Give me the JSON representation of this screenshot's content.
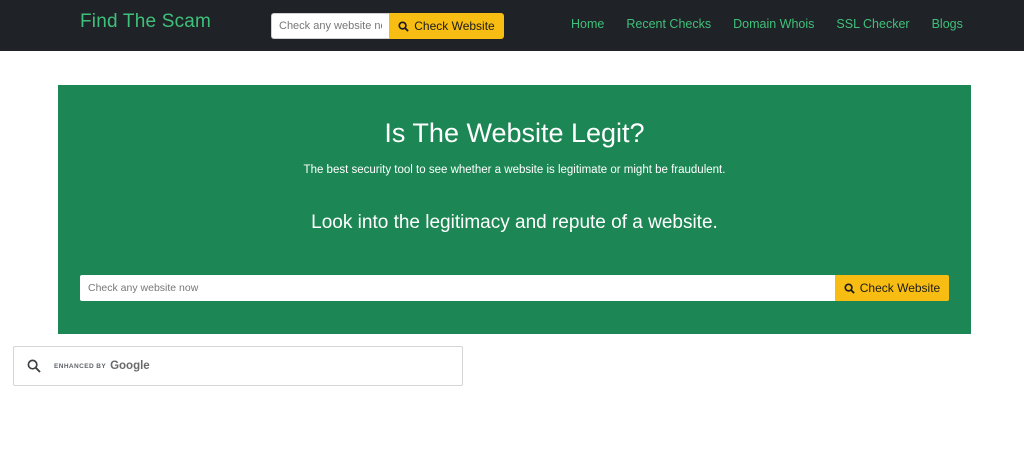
{
  "header": {
    "brand": "Find The Scam",
    "search": {
      "placeholder": "Check any website now",
      "button_label": "Check Website"
    },
    "nav": [
      "Home",
      "Recent Checks",
      "Domain Whois",
      "SSL Checker",
      "Blogs"
    ]
  },
  "hero": {
    "title": "Is The Website Legit?",
    "subtitle": "The best security tool to see whether a website is legitimate or might be fraudulent.",
    "tagline": "Look into the legitimacy and repute of a website.",
    "search": {
      "placeholder": "Check any website now",
      "button_label": "Check Website"
    }
  },
  "google_search": {
    "enhanced_label": "ENHANCED BY",
    "brand": "Google"
  },
  "colors": {
    "topbar": "#1f2226",
    "brand_green": "#3fc07a",
    "hero_green": "#1c8754",
    "button_yellow": "#f7bd12"
  },
  "icons": {
    "search_button": "search-icon",
    "google_search": "search-icon"
  }
}
